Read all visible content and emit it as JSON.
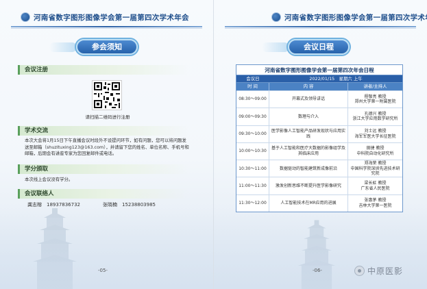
{
  "header_title": "河南省数字图形图像学会第一届第四次学术年会",
  "left": {
    "badge": "参会须知",
    "sections": {
      "registration": "会议注册",
      "exchange": "学术交流",
      "credits": "学分颁取",
      "contacts": "会议联络人"
    },
    "qr_caption": "请扫描二维码进行注册",
    "exchange_text": "本次大会将1月15日下午直播会议时段外不设提问环节，如有问题，您可以将问题发送至邮箱（shuzituxing123@163.com），并请留下您的姓名、单位名称、手机号和邮箱，后期会有讲座专家为您回复邮件或电话。",
    "credits_text": "本次线上会议没有学分。",
    "contact1": "龚志榕　18937836732",
    "contact2": "张晓楠　15238803985",
    "page_num": "-05-"
  },
  "right": {
    "badge": "会议日程",
    "table_title": "河南省数字图形图像学会第一届第四次年会日程",
    "date_label": "会议日",
    "date_value": "2022/01/15　星期六 上午",
    "col_time": "时 间",
    "col_content": "内 容",
    "col_speaker": "讲者/主持人",
    "rows": [
      {
        "time": "08:30～09:00",
        "content": "开幕式及领导讲话",
        "speaker1": "程敬亮 教授",
        "speaker2": "郑州大学第一附属医院"
      },
      {
        "time": "09:00～09:30",
        "content": "数理与介入",
        "speaker1": "孔德兴 教授",
        "speaker2": "浙江大学应用数学研究所"
      },
      {
        "time": "09:30～10:00",
        "content": "医学影像人工智能产品研发现状与应用实践",
        "speaker1": "刘士远 教授",
        "speaker2": "海军军医大学长征医院"
      },
      {
        "time": "10:00～10:30",
        "content": "基于人工智能和医疗大数据的影像组学及其临床应用",
        "speaker1": "田捷 教授",
        "speaker2": "中科院自动化研究所"
      },
      {
        "time": "10:30～11:00",
        "content": "数据驱动的智能建筑新成像前沿",
        "speaker1": "郑海荣 教授",
        "speaker2": "中国科学院深圳先进技术研究院"
      },
      {
        "time": "11:00～11:30",
        "content": "激发创新思维不断提升医学影像研究",
        "speaker1": "梁长虹 教授",
        "speaker2": "广东省人民医院"
      },
      {
        "time": "11:30～12:00",
        "content": "人工智能技术在MR应用的进展",
        "speaker1": "张惠茅 教授",
        "speaker2": "吉林大学第一医院"
      }
    ],
    "page_num": "-06-",
    "watermark": "中原医影"
  }
}
